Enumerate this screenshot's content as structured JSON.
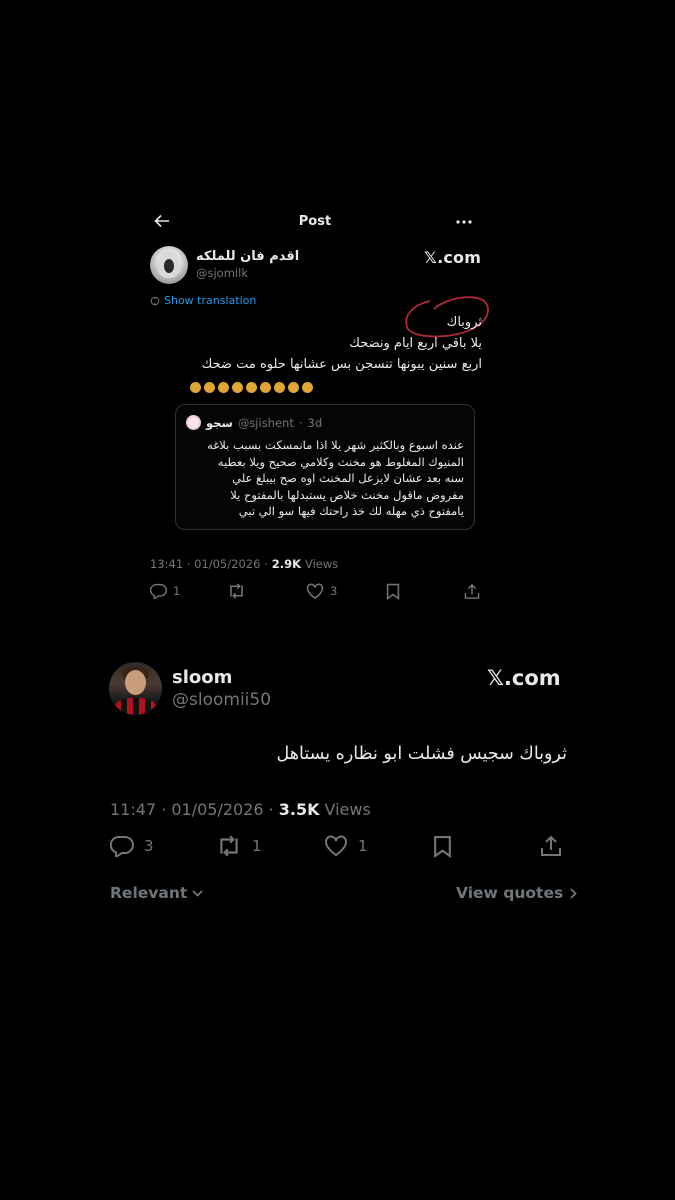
{
  "embedded_post": {
    "header_title": "Post",
    "author": {
      "name": "اقدم فان للملكه",
      "handle": "@sjomilk"
    },
    "brand": "𝕏.com",
    "show_translation": "Show translation",
    "text_lines": [
      "ثروباك",
      "يلا باقي اربع ايام ونضحك",
      "اربع سنين يبونها تنسجن بس عشانها حلوه مت ضحك"
    ],
    "quote": {
      "name": "سجو",
      "handle": "@sjishent",
      "sep": "·",
      "time": "3d",
      "text_lines": [
        "عنده اسبوع وبالكثير شهر يلا اذا مانمسكت بسبب بلاغه",
        "المنيوك المغلوط هو مخنث وكلامي صحيح ويلا بعطيه",
        "سنه بعد عشان لايزعل المخنث اوه صح بيبلغ علي",
        "مفروض ماقول مخنث خلاص يستبدلها بالمفتوح يلا",
        "يامفتوح ذي مهله لك خذ راحتك فيها سو الي تبي"
      ]
    },
    "time": "13:41 · 01/05/2026 ·",
    "views_count": "2.9K",
    "views_label": "Views",
    "replies": "1",
    "likes": "3"
  },
  "main_post": {
    "author": {
      "name": "sloom",
      "handle": "@sloomii50"
    },
    "brand": "𝕏.com",
    "text": "ثروباك سجيس فشلت ابو نظاره يستاهل",
    "time": "11:47 · 01/05/2026 ·",
    "views_count": "3.5K",
    "views_label": "Views",
    "replies": "3",
    "reposts": "1",
    "likes": "1"
  },
  "footer": {
    "sort_label": "Relevant",
    "view_quotes": "View quotes"
  },
  "colors": {
    "background": "#000000",
    "text": "#e7e9ea",
    "muted": "#71767b",
    "link": "#1d9bf0",
    "annotation_circle": "#b0283a"
  },
  "icons": [
    "back-arrow-icon",
    "more-icon",
    "translate-icon",
    "reply-icon",
    "repost-icon",
    "like-icon",
    "bookmark-icon",
    "share-icon",
    "chevron-down-icon",
    "chevron-right-icon"
  ]
}
